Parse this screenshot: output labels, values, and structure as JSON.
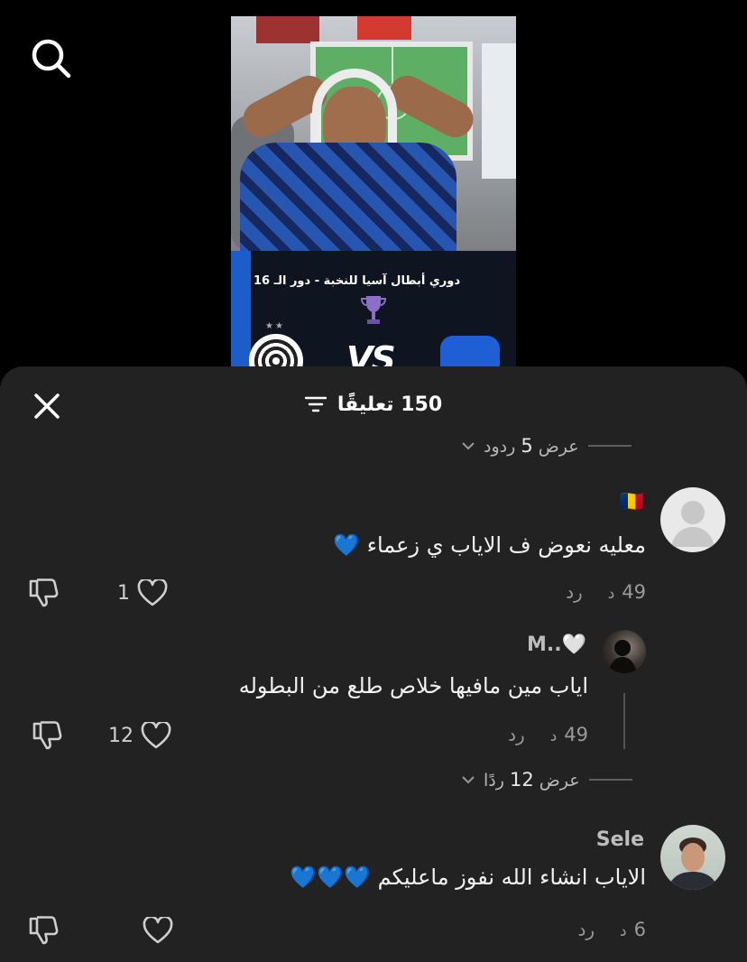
{
  "video": {
    "banner_title": "دوري أبطال آسيا للنخبة - دور الـ 16",
    "vs_label": "VS"
  },
  "comments_panel": {
    "count": "150",
    "title_suffix": "تعليقًا",
    "view_replies_1": {
      "prefix": "عرض",
      "count": "5",
      "suffix": "ردود"
    },
    "view_replies_2": {
      "prefix": "عرض",
      "count": "12",
      "suffix": "ردًا"
    },
    "comments": [
      {
        "username": "🇹🇩",
        "text": "معليه نعوض ف الاياب ي زعماء 💙",
        "time": "49",
        "time_unit": "د",
        "reply": "رد",
        "likes": "1"
      },
      {
        "username": "M..🤍",
        "text": "اياب مين مافيها خلاص طلع من البطوله",
        "time": "49",
        "time_unit": "د",
        "reply": "رد",
        "likes": "12"
      },
      {
        "username": "Sele",
        "text": "الاياب انشاء الله نفوز ماعليكم 💙💙💙",
        "time": "6",
        "time_unit": "د",
        "reply": "رد",
        "likes": ""
      }
    ]
  },
  "colors": {
    "background": "#000000",
    "panel": "#222222",
    "heart_blue": "#1e6ff0"
  },
  "icons": [
    "search-icon",
    "close-icon",
    "filter-icon",
    "chevron-down-icon",
    "heart-outline-icon",
    "dislike-icon",
    "trophy-icon"
  ]
}
